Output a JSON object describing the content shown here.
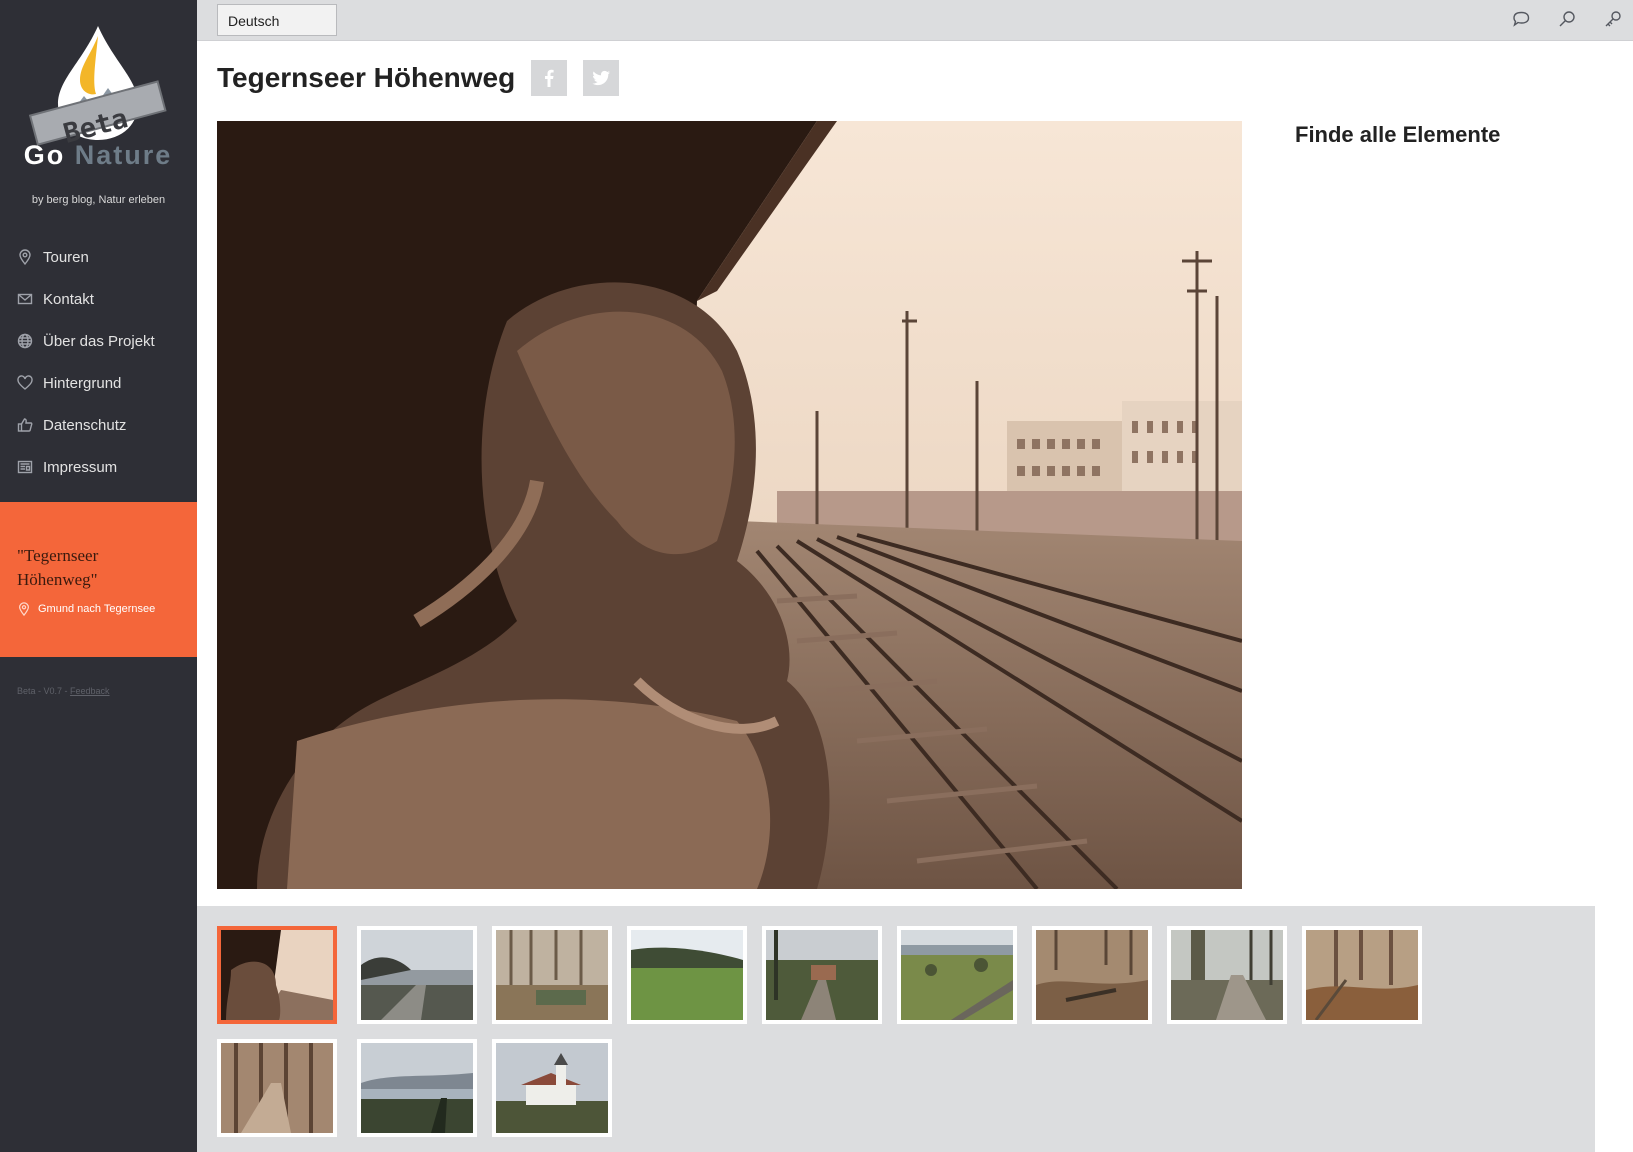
{
  "brand": {
    "logo_text_go": "Go",
    "logo_text_nature": "Nature",
    "beta_badge": "Beta",
    "tagline": "by berg blog, Natur erleben"
  },
  "nav": {
    "items": [
      {
        "label": "Touren",
        "icon": "map-pin-icon"
      },
      {
        "label": "Kontakt",
        "icon": "envelope-icon"
      },
      {
        "label": "Über das Projekt",
        "icon": "globe-icon"
      },
      {
        "label": "Hintergrund",
        "icon": "heart-icon"
      },
      {
        "label": "Datenschutz",
        "icon": "thumbs-up-icon"
      },
      {
        "label": "Impressum",
        "icon": "newspaper-icon"
      }
    ]
  },
  "tour": {
    "title": "\"Tegernseer Höhenweg\"",
    "location": "Gmund nach Tegernsee"
  },
  "footer": {
    "version_text": "Beta - V0.7 - ",
    "feedback_link": "Feedback"
  },
  "topbar": {
    "language": "Deutsch",
    "icons": [
      "speech-bubble-icon",
      "search-icon",
      "key-icon"
    ]
  },
  "page": {
    "title": "Tegernseer Höhenweg",
    "side_title": "Finde alle Elemente"
  },
  "colors": {
    "sidebar": "#2e2f36",
    "accent": "#f4663a",
    "topbar": "#dcdddf"
  },
  "gallery": {
    "thumbnail_count": 12,
    "active_index": 0
  }
}
